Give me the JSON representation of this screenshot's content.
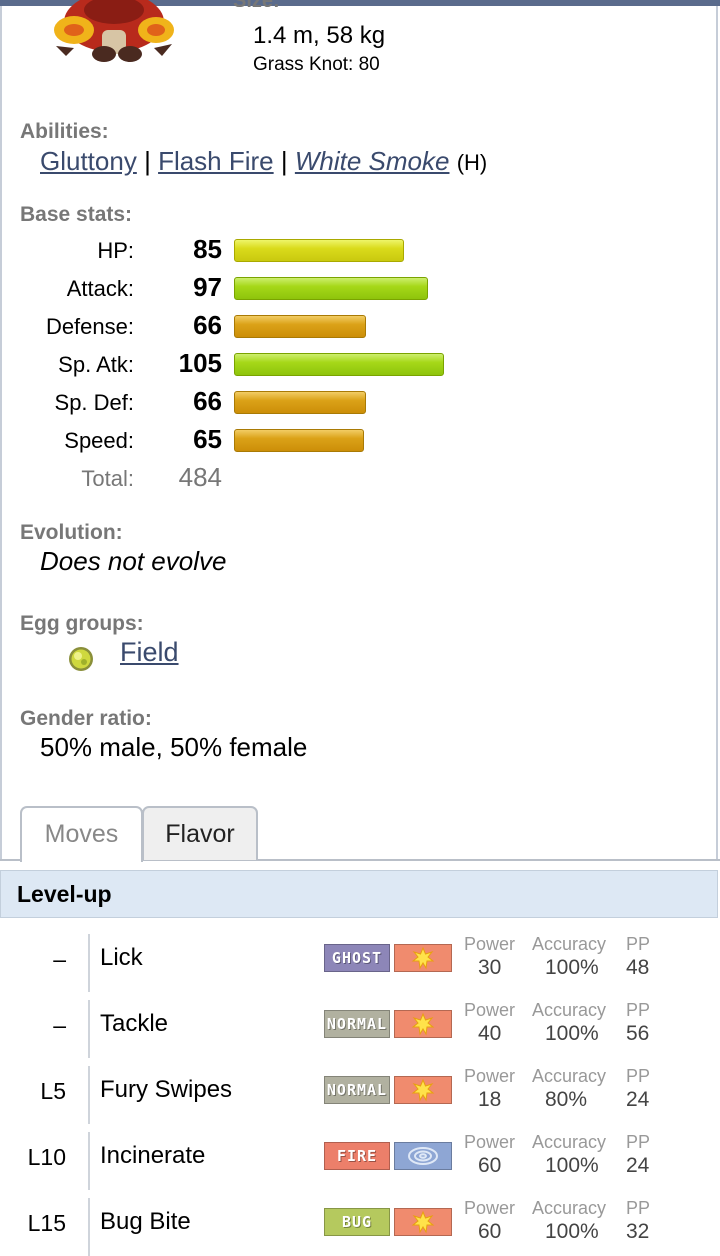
{
  "header": {
    "size_label": "Size:",
    "size_value": "1.4 m, 58 kg",
    "grass_knot": "Grass Knot: 80"
  },
  "abilities": {
    "label": "Abilities:",
    "items": [
      "Gluttony",
      "Flash Fire",
      "White Smoke"
    ],
    "separator": "|",
    "hidden_marker": "(H)"
  },
  "base_stats": {
    "label": "Base stats:",
    "rows": [
      {
        "name": "HP:",
        "value": "85",
        "bar_color": "yellow"
      },
      {
        "name": "Attack:",
        "value": "97",
        "bar_color": "green"
      },
      {
        "name": "Defense:",
        "value": "66",
        "bar_color": "orange"
      },
      {
        "name": "Sp. Atk:",
        "value": "105",
        "bar_color": "green"
      },
      {
        "name": "Sp. Def:",
        "value": "66",
        "bar_color": "orange"
      },
      {
        "name": "Speed:",
        "value": "65",
        "bar_color": "orange"
      }
    ],
    "total_label": "Total:",
    "total_value": "484"
  },
  "evolution": {
    "label": "Evolution:",
    "value": "Does not evolve"
  },
  "egg_groups": {
    "label": "Egg groups:",
    "value": "Field",
    "icon": "field-egg-group-icon"
  },
  "gender": {
    "label": "Gender ratio:",
    "value": "50% male, 50% female"
  },
  "tabs": [
    {
      "label": "Moves",
      "active": true
    },
    {
      "label": "Flavor",
      "active": false
    }
  ],
  "moves_section": {
    "title": "Level-up",
    "col_power": "Power",
    "col_accuracy": "Accuracy",
    "col_pp": "PP",
    "moves": [
      {
        "level": "–",
        "name": "Lick",
        "type": "GHOST",
        "type_color": "#8d86b8",
        "category": "physical",
        "power": "30",
        "accuracy": "100%",
        "pp": "48"
      },
      {
        "level": "–",
        "name": "Tackle",
        "type": "NORMAL",
        "type_color": "#b1b1a0",
        "category": "physical",
        "power": "40",
        "accuracy": "100%",
        "pp": "56"
      },
      {
        "level": "L5",
        "name": "Fury Swipes",
        "type": "NORMAL",
        "type_color": "#b1b1a0",
        "category": "physical",
        "power": "18",
        "accuracy": "80%",
        "pp": "24"
      },
      {
        "level": "L10",
        "name": "Incinerate",
        "type": "FIRE",
        "type_color": "#ec7f6a",
        "category": "special",
        "power": "60",
        "accuracy": "100%",
        "pp": "24"
      },
      {
        "level": "L15",
        "name": "Bug Bite",
        "type": "BUG",
        "type_color": "#b5c95e",
        "category": "physical",
        "power": "60",
        "accuracy": "100%",
        "pp": "32"
      }
    ]
  },
  "colors": {
    "link": "#3a4a6d",
    "section_header_bg": "#dde8f4",
    "physical_badge": "#f08b6e",
    "special_badge": "#8ea6d4"
  }
}
